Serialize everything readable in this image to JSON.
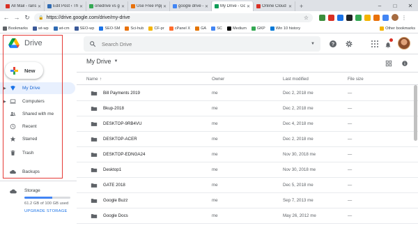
{
  "browser": {
    "tabs": [
      {
        "title": "All Mail - ransa...",
        "color": "#d93025",
        "active": false
      },
      {
        "title": "Edit Post ‹ The ...",
        "color": "#2f6bb3",
        "active": false
      },
      {
        "title": "onedrive vs go...",
        "color": "#34a853",
        "active": false
      },
      {
        "title": "Use Free Pipp...",
        "color": "#e8710a",
        "active": false
      },
      {
        "title": "google drive -...",
        "color": "#4285f4",
        "active": false
      },
      {
        "title": "My Drive - Goo...",
        "color": "#0f9d58",
        "active": true
      },
      {
        "title": "Online Cloud F...",
        "color": "#d93025",
        "active": false
      }
    ],
    "new_tab": "+",
    "window_controls": [
      "–",
      "□",
      "✕"
    ],
    "url": "https://drive.google.com/drive/my-drive",
    "bookmarks": [
      {
        "label": "Bookmarks",
        "color": "#5f6368"
      },
      {
        "label": "wt-wp",
        "color": "#3b5998"
      },
      {
        "label": "wt-cm",
        "color": "#2f6bb3"
      },
      {
        "label": "SEO-wp",
        "color": "#3b5998"
      },
      {
        "label": "SEO-SM",
        "color": "#1a73e8"
      },
      {
        "label": "Sci-hub",
        "color": "#e8710a"
      },
      {
        "label": "CF-pr",
        "color": "#f4b400"
      },
      {
        "label": "cPanel X",
        "color": "#ff6c2c"
      },
      {
        "label": "GA",
        "color": "#e37400"
      },
      {
        "label": "SC",
        "color": "#4285f4"
      },
      {
        "label": "Medium",
        "color": "#000000"
      },
      {
        "label": "GKP",
        "color": "#34a853"
      },
      {
        "label": "Win 10 history",
        "color": "#0078d7"
      }
    ],
    "other_bookmarks": "Other bookmarks"
  },
  "header": {
    "app_name": "Drive",
    "search_placeholder": "Search Drive"
  },
  "sidebar": {
    "new_label": "New",
    "items": [
      {
        "label": "My Drive",
        "icon": "my-drive-icon",
        "active": true,
        "caret": true
      },
      {
        "label": "Computers",
        "icon": "computers-icon",
        "active": false,
        "caret": true
      },
      {
        "label": "Shared with me",
        "icon": "shared-icon",
        "active": false,
        "caret": false
      },
      {
        "label": "Recent",
        "icon": "clock-icon",
        "active": false,
        "caret": false
      },
      {
        "label": "Starred",
        "icon": "star-icon",
        "active": false,
        "caret": false
      },
      {
        "label": "Trash",
        "icon": "trash-icon",
        "active": false,
        "caret": false
      },
      {
        "label": "Backups",
        "icon": "cloud-icon",
        "active": false,
        "caret": false
      }
    ],
    "storage": {
      "label": "Storage",
      "used_text": "61.2 GB of 100 GB used",
      "used_fraction": 0.612,
      "upgrade_label": "UPGRADE STORAGE"
    }
  },
  "main": {
    "title": "My Drive",
    "columns": {
      "name": "Name",
      "sort_arrow": "↑",
      "owner": "Owner",
      "last_modified": "Last modified",
      "file_size": "File size"
    },
    "rows": [
      {
        "name": "Bill Payments 2019",
        "owner": "me",
        "modified": "Dec 2, 2018 me",
        "size": "—"
      },
      {
        "name": "Bkup-2018",
        "owner": "me",
        "modified": "Dec 2, 2018 me",
        "size": "—"
      },
      {
        "name": "DESKTOP-9RB4VU",
        "owner": "me",
        "modified": "Dec 4, 2018 me",
        "size": "—"
      },
      {
        "name": "DESKTOP-ACER",
        "owner": "me",
        "modified": "Dec 2, 2018 me",
        "size": "—"
      },
      {
        "name": "DESKTOP-EDNGA24",
        "owner": "me",
        "modified": "Nov 30, 2018 me",
        "size": "—"
      },
      {
        "name": "Desktop1",
        "owner": "me",
        "modified": "Nov 30, 2018 me",
        "size": "—"
      },
      {
        "name": "GATE 2018",
        "owner": "me",
        "modified": "Dec 5, 2018 me",
        "size": "—"
      },
      {
        "name": "Google Buzz",
        "owner": "me",
        "modified": "Sep 7, 2013 me",
        "size": "—"
      },
      {
        "name": "Google Docs",
        "owner": "me",
        "modified": "May 26, 2012 me",
        "size": "—"
      }
    ]
  },
  "colors": {
    "accent": "#1a73e8",
    "active_bg": "#e8f0fe",
    "highlight": "#e53935",
    "folder": "#5f6368"
  }
}
